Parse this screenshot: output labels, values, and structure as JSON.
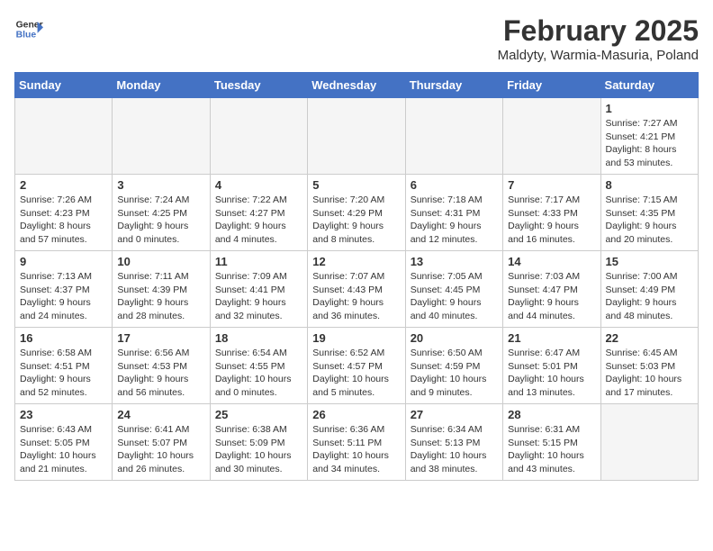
{
  "header": {
    "logo_general": "General",
    "logo_blue": "Blue",
    "title": "February 2025",
    "subtitle": "Maldyty, Warmia-Masuria, Poland"
  },
  "days_of_week": [
    "Sunday",
    "Monday",
    "Tuesday",
    "Wednesday",
    "Thursday",
    "Friday",
    "Saturday"
  ],
  "weeks": [
    [
      {
        "day": "",
        "info": ""
      },
      {
        "day": "",
        "info": ""
      },
      {
        "day": "",
        "info": ""
      },
      {
        "day": "",
        "info": ""
      },
      {
        "day": "",
        "info": ""
      },
      {
        "day": "",
        "info": ""
      },
      {
        "day": "1",
        "info": "Sunrise: 7:27 AM\nSunset: 4:21 PM\nDaylight: 8 hours and 53 minutes."
      }
    ],
    [
      {
        "day": "2",
        "info": "Sunrise: 7:26 AM\nSunset: 4:23 PM\nDaylight: 8 hours and 57 minutes."
      },
      {
        "day": "3",
        "info": "Sunrise: 7:24 AM\nSunset: 4:25 PM\nDaylight: 9 hours and 0 minutes."
      },
      {
        "day": "4",
        "info": "Sunrise: 7:22 AM\nSunset: 4:27 PM\nDaylight: 9 hours and 4 minutes."
      },
      {
        "day": "5",
        "info": "Sunrise: 7:20 AM\nSunset: 4:29 PM\nDaylight: 9 hours and 8 minutes."
      },
      {
        "day": "6",
        "info": "Sunrise: 7:18 AM\nSunset: 4:31 PM\nDaylight: 9 hours and 12 minutes."
      },
      {
        "day": "7",
        "info": "Sunrise: 7:17 AM\nSunset: 4:33 PM\nDaylight: 9 hours and 16 minutes."
      },
      {
        "day": "8",
        "info": "Sunrise: 7:15 AM\nSunset: 4:35 PM\nDaylight: 9 hours and 20 minutes."
      }
    ],
    [
      {
        "day": "9",
        "info": "Sunrise: 7:13 AM\nSunset: 4:37 PM\nDaylight: 9 hours and 24 minutes."
      },
      {
        "day": "10",
        "info": "Sunrise: 7:11 AM\nSunset: 4:39 PM\nDaylight: 9 hours and 28 minutes."
      },
      {
        "day": "11",
        "info": "Sunrise: 7:09 AM\nSunset: 4:41 PM\nDaylight: 9 hours and 32 minutes."
      },
      {
        "day": "12",
        "info": "Sunrise: 7:07 AM\nSunset: 4:43 PM\nDaylight: 9 hours and 36 minutes."
      },
      {
        "day": "13",
        "info": "Sunrise: 7:05 AM\nSunset: 4:45 PM\nDaylight: 9 hours and 40 minutes."
      },
      {
        "day": "14",
        "info": "Sunrise: 7:03 AM\nSunset: 4:47 PM\nDaylight: 9 hours and 44 minutes."
      },
      {
        "day": "15",
        "info": "Sunrise: 7:00 AM\nSunset: 4:49 PM\nDaylight: 9 hours and 48 minutes."
      }
    ],
    [
      {
        "day": "16",
        "info": "Sunrise: 6:58 AM\nSunset: 4:51 PM\nDaylight: 9 hours and 52 minutes."
      },
      {
        "day": "17",
        "info": "Sunrise: 6:56 AM\nSunset: 4:53 PM\nDaylight: 9 hours and 56 minutes."
      },
      {
        "day": "18",
        "info": "Sunrise: 6:54 AM\nSunset: 4:55 PM\nDaylight: 10 hours and 0 minutes."
      },
      {
        "day": "19",
        "info": "Sunrise: 6:52 AM\nSunset: 4:57 PM\nDaylight: 10 hours and 5 minutes."
      },
      {
        "day": "20",
        "info": "Sunrise: 6:50 AM\nSunset: 4:59 PM\nDaylight: 10 hours and 9 minutes."
      },
      {
        "day": "21",
        "info": "Sunrise: 6:47 AM\nSunset: 5:01 PM\nDaylight: 10 hours and 13 minutes."
      },
      {
        "day": "22",
        "info": "Sunrise: 6:45 AM\nSunset: 5:03 PM\nDaylight: 10 hours and 17 minutes."
      }
    ],
    [
      {
        "day": "23",
        "info": "Sunrise: 6:43 AM\nSunset: 5:05 PM\nDaylight: 10 hours and 21 minutes."
      },
      {
        "day": "24",
        "info": "Sunrise: 6:41 AM\nSunset: 5:07 PM\nDaylight: 10 hours and 26 minutes."
      },
      {
        "day": "25",
        "info": "Sunrise: 6:38 AM\nSunset: 5:09 PM\nDaylight: 10 hours and 30 minutes."
      },
      {
        "day": "26",
        "info": "Sunrise: 6:36 AM\nSunset: 5:11 PM\nDaylight: 10 hours and 34 minutes."
      },
      {
        "day": "27",
        "info": "Sunrise: 6:34 AM\nSunset: 5:13 PM\nDaylight: 10 hours and 38 minutes."
      },
      {
        "day": "28",
        "info": "Sunrise: 6:31 AM\nSunset: 5:15 PM\nDaylight: 10 hours and 43 minutes."
      },
      {
        "day": "",
        "info": ""
      }
    ]
  ]
}
